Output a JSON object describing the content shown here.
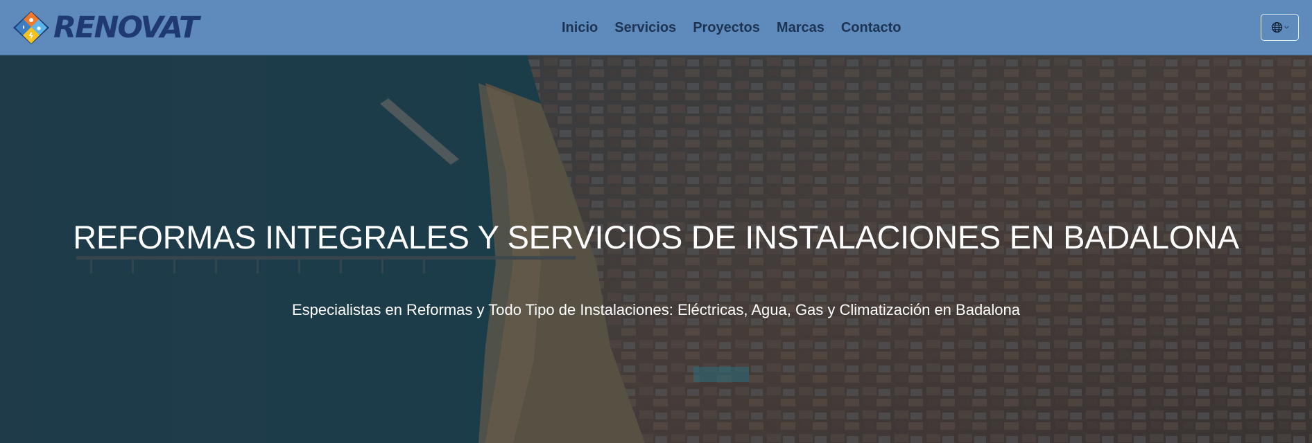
{
  "brand": {
    "name": "RENOVAT",
    "colors": {
      "blue": "#3f7dc1",
      "orange": "#f07a2a",
      "yellow": "#f4c223",
      "light_blue": "#5ab5e8",
      "text": "#1f3a72"
    }
  },
  "nav": {
    "items": [
      {
        "label": "Inicio"
      },
      {
        "label": "Servicios"
      },
      {
        "label": "Proyectos"
      },
      {
        "label": "Marcas"
      },
      {
        "label": "Contacto"
      }
    ]
  },
  "language_selector": {
    "icon": "globe-icon",
    "chevron": "chevron-down-icon"
  },
  "hero": {
    "title": "REFORMAS INTEGRALES Y SERVICIOS DE INSTALACIONES EN BADALONA",
    "subtitle": "Especialistas en Reformas y Todo Tipo de Instalaciones: Eléctricas, Agua, Gas y Climatización en Badalona"
  },
  "colors": {
    "header_bg": "#5e8bbb",
    "nav_text": "#1d3353",
    "hero_text": "#ffffff"
  }
}
